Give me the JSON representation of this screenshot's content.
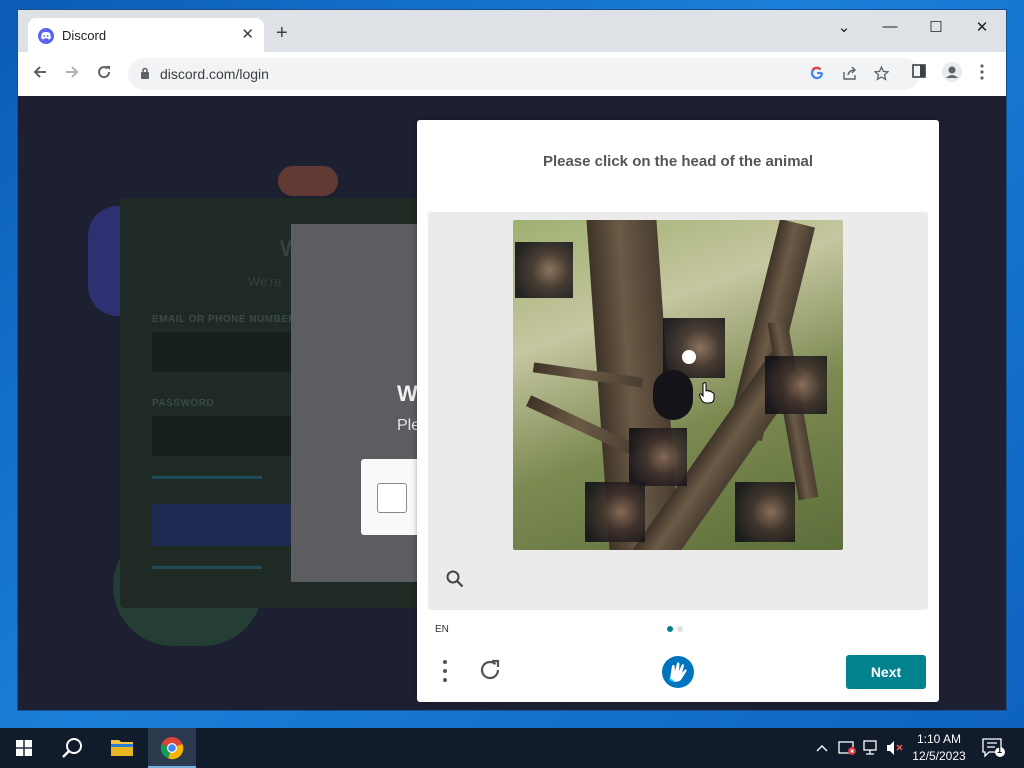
{
  "browser": {
    "tab_title": "Discord",
    "new_tab_symbol": "+",
    "tab_close_symbol": "✕",
    "url": "discord.com/login",
    "window_controls": {
      "dropdown": "⌄",
      "minimize": "—",
      "maximize": "☐",
      "close": "✕"
    }
  },
  "login_page": {
    "email_label": "EMAIL OR PHONE NUMBER",
    "password_label": "PASSWORD",
    "greeting_partial": "W",
    "subtitle_partial": "We're",
    "overlay_heading_partial": "W",
    "overlay_text_partial": "Ple"
  },
  "captcha": {
    "prompt": "Please click on the head of the animal",
    "language": "EN",
    "next_label": "Next",
    "page_indicator": {
      "current": 1,
      "total": 2
    },
    "accent_color": "#00838f"
  },
  "taskbar": {
    "time": "1:10 AM",
    "date": "12/5/2023",
    "notification_count": "1",
    "pinned": [
      "start-icon",
      "search-icon",
      "file-explorer-icon",
      "chrome-icon"
    ]
  }
}
